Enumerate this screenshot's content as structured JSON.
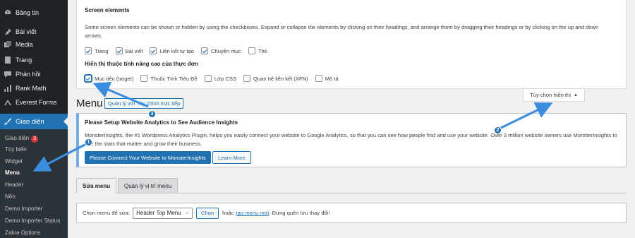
{
  "sidebar": {
    "items": [
      {
        "label": "Bảng tin",
        "icon": "dashboard-icon"
      },
      {
        "label": "Bài viết",
        "icon": "pin-icon"
      },
      {
        "label": "Media",
        "icon": "media-icon"
      },
      {
        "label": "Trang",
        "icon": "page-icon"
      },
      {
        "label": "Phản hồi",
        "icon": "comment-icon"
      },
      {
        "label": "Rank Math",
        "icon": "chart-icon"
      },
      {
        "label": "Everest Forms",
        "icon": "form-icon"
      },
      {
        "label": "Giao diện",
        "icon": "brush-icon"
      }
    ],
    "submenu": [
      {
        "label": "Giao diện",
        "badge": "3"
      },
      {
        "label": "Tùy biến"
      },
      {
        "label": "Widget"
      },
      {
        "label": "Menu"
      },
      {
        "label": "Header"
      },
      {
        "label": "Nền"
      },
      {
        "label": "Demo Importer"
      },
      {
        "label": "Demo Importer Status"
      },
      {
        "label": "Zakra Options"
      }
    ]
  },
  "screen_options": {
    "heading": "Screen elements",
    "description": "Some screen elements can be shown or hidden by using the checkboxes. Expand or collapse the elements by clicking on their headings, and arrange them by dragging their headings or by clicking on the up and down arrows.",
    "elements": [
      {
        "label": "Trang",
        "checked": true
      },
      {
        "label": "Bài viết",
        "checked": true
      },
      {
        "label": "Liên kết tự tạo",
        "checked": true
      },
      {
        "label": "Chuyên mục",
        "checked": true
      },
      {
        "label": "Thẻ",
        "checked": false
      }
    ],
    "advanced_heading": "Hiển thị thuộc tính nâng cao của thực đơn",
    "advanced": [
      {
        "label": "Mục tiêu (target)",
        "checked": true
      },
      {
        "label": "Thuộc Tính Tiêu Đề",
        "checked": false
      },
      {
        "label": "Lớp CSS",
        "checked": false
      },
      {
        "label": "Quan hệ liên kết (XFN)",
        "checked": false
      },
      {
        "label": "Mô tả",
        "checked": false
      }
    ],
    "toggle_label": "Tùy chọn hiển thị"
  },
  "page": {
    "title": "Menu",
    "manage_live": "Quản lý với Tùy chỉnh trực tiếp"
  },
  "notice": {
    "title": "Please Setup Website Analytics to See Audience Insights",
    "text": "MonsterInsights, the #1 Wordpress Analytics Plugin, helps you easily connect your website to Google Analytics, so that you can see how people find and use your website. Over 3 million website owners use MonsterInsights to see the stats that matter and grow their business.",
    "primary_button": "Please Connect Your Website to MonsterInsights",
    "secondary_button": "Learn More"
  },
  "tabs": [
    {
      "label": "Sửa menu",
      "active": true
    },
    {
      "label": "Quản lý vị trí menu",
      "active": false
    }
  ],
  "select_menu": {
    "label": "Chọn menu để sửa:",
    "selected": "Header Top Menu",
    "select_button": "Chọn",
    "or_text": "hoặc",
    "new_menu_link": "tạo menu mới",
    "tail_text": ". Đừng quên lưu thay đổi!"
  },
  "annotations": {
    "step1": "1",
    "step2": "2",
    "step3": "3"
  },
  "colors": {
    "sidebar_bg": "#1d2327",
    "accent": "#2271b1",
    "annotation": "#3b8de0"
  }
}
